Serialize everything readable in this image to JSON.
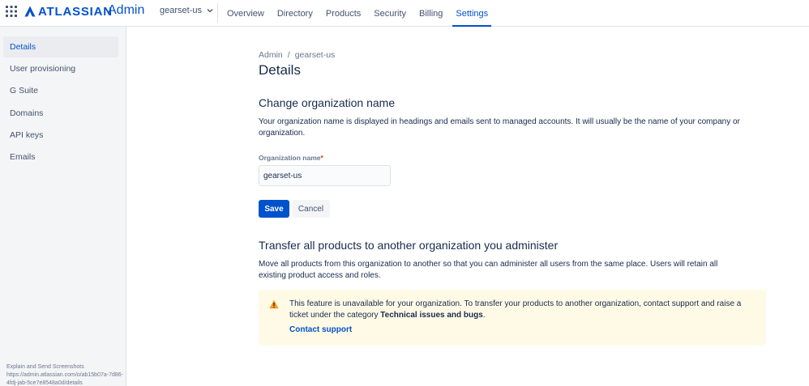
{
  "header": {
    "logo_text": "ATLASSIAN",
    "product_name": "Admin",
    "org_switcher": "gearset-us",
    "nav": [
      {
        "label": "Overview"
      },
      {
        "label": "Directory"
      },
      {
        "label": "Products"
      },
      {
        "label": "Security"
      },
      {
        "label": "Billing"
      },
      {
        "label": "Settings",
        "active": true
      }
    ]
  },
  "sidebar": {
    "items": [
      {
        "label": "Details",
        "active": true
      },
      {
        "label": "User provisioning"
      },
      {
        "label": "G Suite"
      },
      {
        "label": "Domains"
      },
      {
        "label": "API keys"
      },
      {
        "label": "Emails"
      }
    ],
    "footer_line1": "Explain and Send Screenshots",
    "footer_line2": "https://admin.atlassian.com/o/ab15b07a-7d86-4fdj-jab-5ce7e8548a0d/details"
  },
  "main": {
    "breadcrumb": [
      "Admin",
      "gearset-us"
    ],
    "breadcrumb_separator": "/",
    "title": "Details",
    "change_name": {
      "heading": "Change organization name",
      "description": "Your organization name is displayed in headings and emails sent to managed accounts. It will usually be the name of your company or organization.",
      "field_label": "Organization name",
      "required_mark": "*",
      "field_value": "gearset-us",
      "save_label": "Save",
      "cancel_label": "Cancel"
    },
    "transfer": {
      "heading": "Transfer all products to another organization you administer",
      "description": "Move all products from this organization to another so that you can administer all users from the same place. Users will retain all existing product access and roles.",
      "warning_text_before": "This feature is unavailable for your organization. To transfer your products to another organization, contact support and raise a ticket under the category ",
      "warning_text_bold": "Technical issues and bugs",
      "warning_text_after": ".",
      "warning_link": "Contact support"
    }
  },
  "colors": {
    "brand": "#0052CC",
    "warning_bg": "#FFFAE6",
    "warning_icon": "#FF991F",
    "sidebar_bg": "#F4F5F7"
  },
  "icons": {
    "apps": "app-switcher-grid-icon",
    "logo": "atlassian-logo-icon",
    "chevron": "chevron-down-icon",
    "warning": "warning-icon"
  }
}
